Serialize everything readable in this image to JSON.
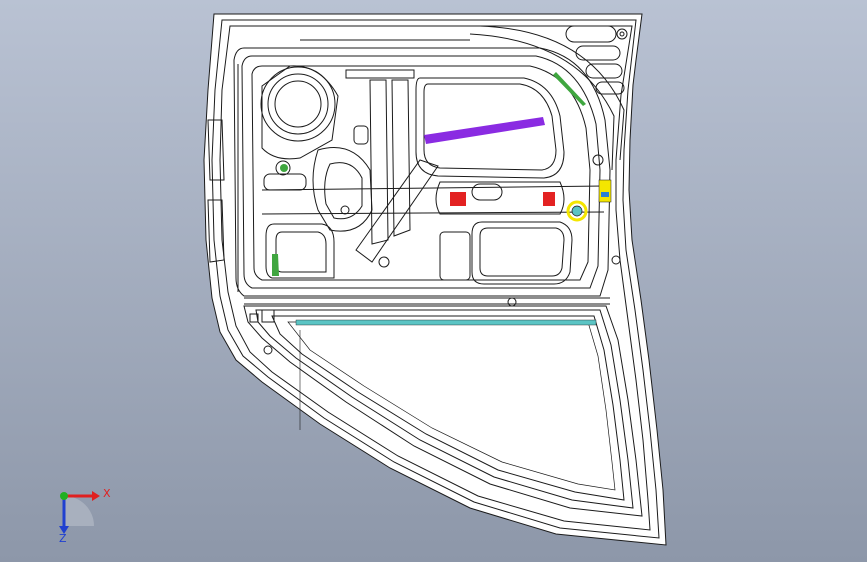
{
  "viewport": {
    "background_top": "#b9c2d3",
    "background_bottom": "#8d97a9",
    "line_color": "#1b1b1b",
    "part_fill": "#ffffff"
  },
  "highlights": {
    "purple_bar": "#8a2be2",
    "red_mark": "#e32222",
    "yellow_mark": "#f4e600",
    "green_mark": "#3fa63f",
    "cyan_strip": "#5bc4c4",
    "blue_mark": "#2a7fd4"
  },
  "triad": {
    "x_label": "X",
    "z_label": "Z",
    "x_color": "#e02020",
    "y_color": "#20b020",
    "z_color": "#2040d0"
  }
}
